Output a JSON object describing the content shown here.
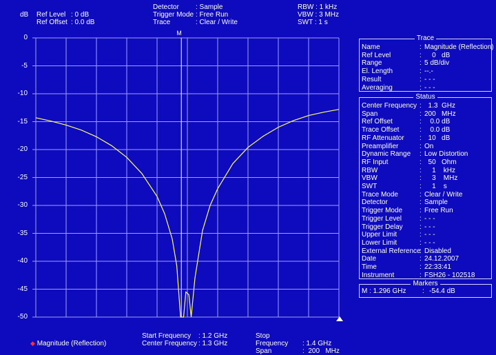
{
  "header": {
    "y_unit": "dB",
    "ref_level": {
      "label": "Ref Level",
      "value": ": 0   dB"
    },
    "ref_offset": {
      "label": "Ref Offset",
      "value": ": 0.0 dB"
    },
    "detector": {
      "label": "Detector",
      "value": ": Sample"
    },
    "trigger_mode": {
      "label": "Trigger Mode",
      "value": ": Free Run"
    },
    "trace": {
      "label": "Trace",
      "value": ": Clear / Write"
    },
    "rbw": "RBW : 1 kHz",
    "vbw": "VBW : 3 MHz",
    "swt": "SWT : 1 s"
  },
  "marker_tag": "M",
  "chart_data": {
    "type": "line",
    "ylim": [
      -50,
      0
    ],
    "xlim": [
      1.2,
      1.4
    ],
    "x_unit": "GHz",
    "yticks": [
      "0",
      "-5",
      "-10",
      "-15",
      "-20",
      "-25",
      "-30",
      "-35",
      "-40",
      "-45",
      "-50"
    ],
    "grid": true,
    "series": [
      {
        "name": "Magnitude (Reflection)",
        "color": "#ffff66",
        "x": [
          1.2,
          1.21,
          1.22,
          1.23,
          1.24,
          1.25,
          1.26,
          1.27,
          1.28,
          1.285,
          1.29,
          1.293,
          1.2955,
          1.2975,
          1.299,
          1.301,
          1.3025,
          1.305,
          1.31,
          1.315,
          1.32,
          1.33,
          1.34,
          1.35,
          1.36,
          1.37,
          1.38,
          1.39,
          1.4
        ],
        "y": [
          -14.3,
          -14.9,
          -15.6,
          -16.5,
          -17.7,
          -19.3,
          -21.4,
          -24.3,
          -28.4,
          -31.5,
          -36,
          -40.8,
          -50,
          -50,
          -45.5,
          -46,
          -50,
          -43,
          -34.5,
          -30,
          -27,
          -22.5,
          -19.6,
          -17.6,
          -16,
          -14.8,
          -13.9,
          -13.3,
          -12.8
        ]
      }
    ],
    "marker": {
      "x": 1.296,
      "y": -54.4
    }
  },
  "footer": {
    "legend_label": "Magnitude (Reflection)",
    "start_freq": {
      "label": "Start Frequency",
      "value": ": 1.2 GHz"
    },
    "center_freq": {
      "label": "Center Frequency",
      "value": ": 1.3 GHz"
    },
    "stop_freq": {
      "label": "Stop Frequency",
      "value": ": 1.4 GHz"
    },
    "span": {
      "label": "Span",
      "value": ":  200   MHz"
    }
  },
  "trace_panel": {
    "title": "Trace",
    "rows": [
      {
        "key": "Name",
        "value": "Magnitude (Reflection)"
      },
      {
        "key": "Ref Level",
        "value": "    0   dB"
      },
      {
        "key": "Range",
        "value": "5 dB/div"
      },
      {
        "key": "El. Length",
        "value": "--.-"
      },
      {
        "key": "Result",
        "value": "- - -"
      },
      {
        "key": "Averaging",
        "value": "- - -"
      }
    ]
  },
  "status_panel": {
    "title": "Status",
    "rows": [
      {
        "key": "Center Frequency",
        "value": "  1.3  GHz"
      },
      {
        "key": "Span",
        "value": "200   MHz"
      },
      {
        "key": "Ref Offset",
        "value": "   0.0 dB"
      },
      {
        "key": "Trace Offset",
        "value": "   0.0 dB"
      },
      {
        "key": "RF Attenuator",
        "value": "  10   dB"
      },
      {
        "key": "Preamplifier",
        "value": "On"
      },
      {
        "key": "Dynamic Range",
        "value": "Low Distortion"
      },
      {
        "key": "RF Input",
        "value": "  50   Ohm"
      },
      {
        "key": "RBW",
        "value": "    1    kHz"
      },
      {
        "key": "VBW",
        "value": "    3    MHz"
      },
      {
        "key": "SWT",
        "value": "    1    s"
      },
      {
        "key": "Trace Mode",
        "value": "Clear / Write"
      },
      {
        "key": "Detector",
        "value": "Sample"
      },
      {
        "key": "Trigger Mode",
        "value": "Free Run"
      },
      {
        "key": "Trigger Level",
        "value": "- - -"
      },
      {
        "key": "Trigger Delay",
        "value": "- - -"
      },
      {
        "key": "Upper Limit",
        "value": "- - -"
      },
      {
        "key": "Lower Limit",
        "value": "- - -"
      },
      {
        "key": "External Reference",
        "value": "Disabled"
      },
      {
        "key": "Date",
        "value": "24.12.2007"
      },
      {
        "key": "Time",
        "value": "22:33:41"
      },
      {
        "key": "Instrument",
        "value": "FSH26 - 102518"
      }
    ]
  },
  "markers_panel": {
    "title": "Markers",
    "entry_key": "M : 1.296 GHz",
    "entry_value": "-54.4 dB"
  }
}
